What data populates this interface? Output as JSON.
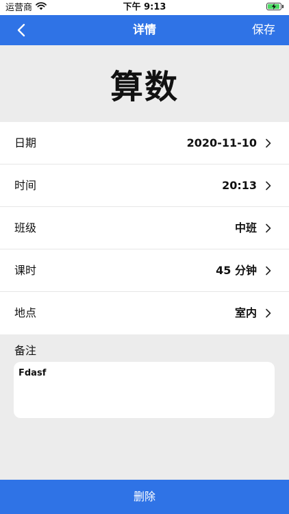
{
  "status_bar": {
    "carrier": "运营商",
    "time": "下午 9:13",
    "icons": [
      "wifi-icon",
      "battery-charging-icon"
    ]
  },
  "nav": {
    "back_icon": "chevron-left-icon",
    "title": "详情",
    "save_label": "保存"
  },
  "subject": {
    "title": "算数"
  },
  "rows": [
    {
      "label": "日期",
      "value": "2020-11-10"
    },
    {
      "label": "时间",
      "value": "20:13"
    },
    {
      "label": "班级",
      "value": "中班"
    },
    {
      "label": "课时",
      "value": "45 分钟"
    },
    {
      "label": "地点",
      "value": "室内"
    }
  ],
  "notes": {
    "label": "备注",
    "value": "Fdasf"
  },
  "delete": {
    "label": "删除"
  },
  "colors": {
    "accent": "#2f73e6",
    "background": "#ececec",
    "battery": "#4cd964"
  }
}
